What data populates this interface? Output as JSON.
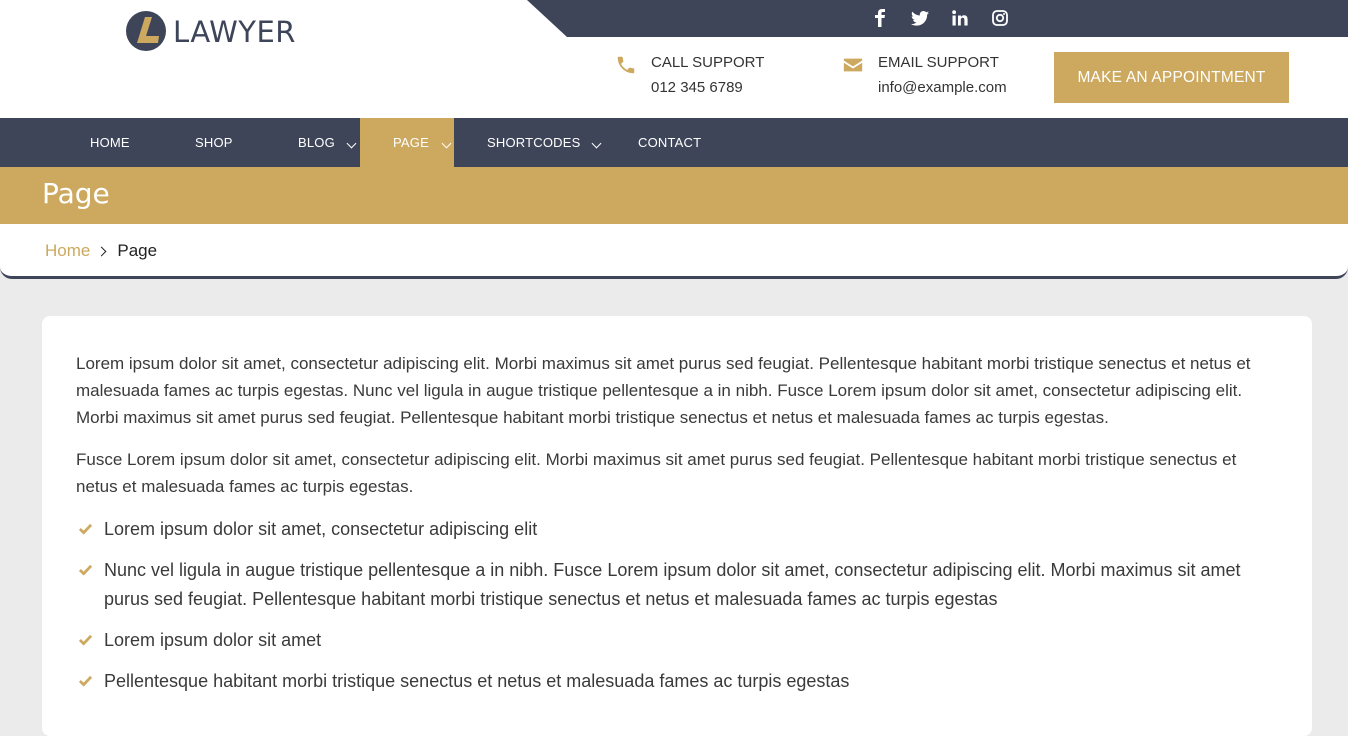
{
  "brand": {
    "name": "LAWYER"
  },
  "social": [
    {
      "icon": "facebook-icon"
    },
    {
      "icon": "twitter-icon"
    },
    {
      "icon": "linkedin-icon"
    },
    {
      "icon": "instagram-icon"
    }
  ],
  "contact": {
    "call_label": "CALL SUPPORT",
    "call_value": "012 345 6789",
    "email_label": "EMAIL SUPPORT",
    "email_value": "info@example.com",
    "appointment_label": "MAKE AN APPOINTMENT"
  },
  "nav": {
    "items": [
      {
        "label": "HOME"
      },
      {
        "label": "SHOP"
      },
      {
        "label": "BLOG"
      },
      {
        "label": "PAGE"
      },
      {
        "label": "SHORTCODES"
      },
      {
        "label": "CONTACT"
      }
    ]
  },
  "page": {
    "title": "Page",
    "breadcrumb_home": "Home",
    "breadcrumb_current": "Page"
  },
  "content": {
    "p1": "Lorem ipsum dolor sit amet, consectetur adipiscing elit. Morbi maximus sit amet purus sed feugiat. Pellentesque habitant morbi tristique senectus et netus et malesuada fames ac turpis egestas. Nunc vel ligula in augue tristique pellentesque a in nibh. Fusce Lorem ipsum dolor sit amet, consectetur adipiscing elit. Morbi maximus sit amet purus sed feugiat. Pellentesque habitant morbi tristique senectus et netus et malesuada fames ac turpis egestas.",
    "p2": "Fusce Lorem ipsum dolor sit amet, consectetur adipiscing elit. Morbi maximus sit amet purus sed feugiat. Pellentesque habitant morbi tristique senectus et netus et malesuada fames ac turpis egestas.",
    "bullets": [
      "Lorem ipsum dolor sit amet, consectetur adipiscing elit",
      "Nunc vel ligula in augue tristique pellentesque a in nibh. Fusce Lorem ipsum dolor sit amet, consectetur adipiscing elit. Morbi maximus sit amet purus sed feugiat. Pellentesque habitant morbi tristique senectus et netus et malesuada fames ac turpis egestas",
      "Lorem ipsum dolor sit amet",
      "Pellentesque habitant morbi tristique senectus et netus et malesuada fames ac turpis egestas"
    ]
  },
  "colors": {
    "navy": "#3e4559",
    "gold": "#cca95f",
    "page_bg": "#ebebeb"
  }
}
